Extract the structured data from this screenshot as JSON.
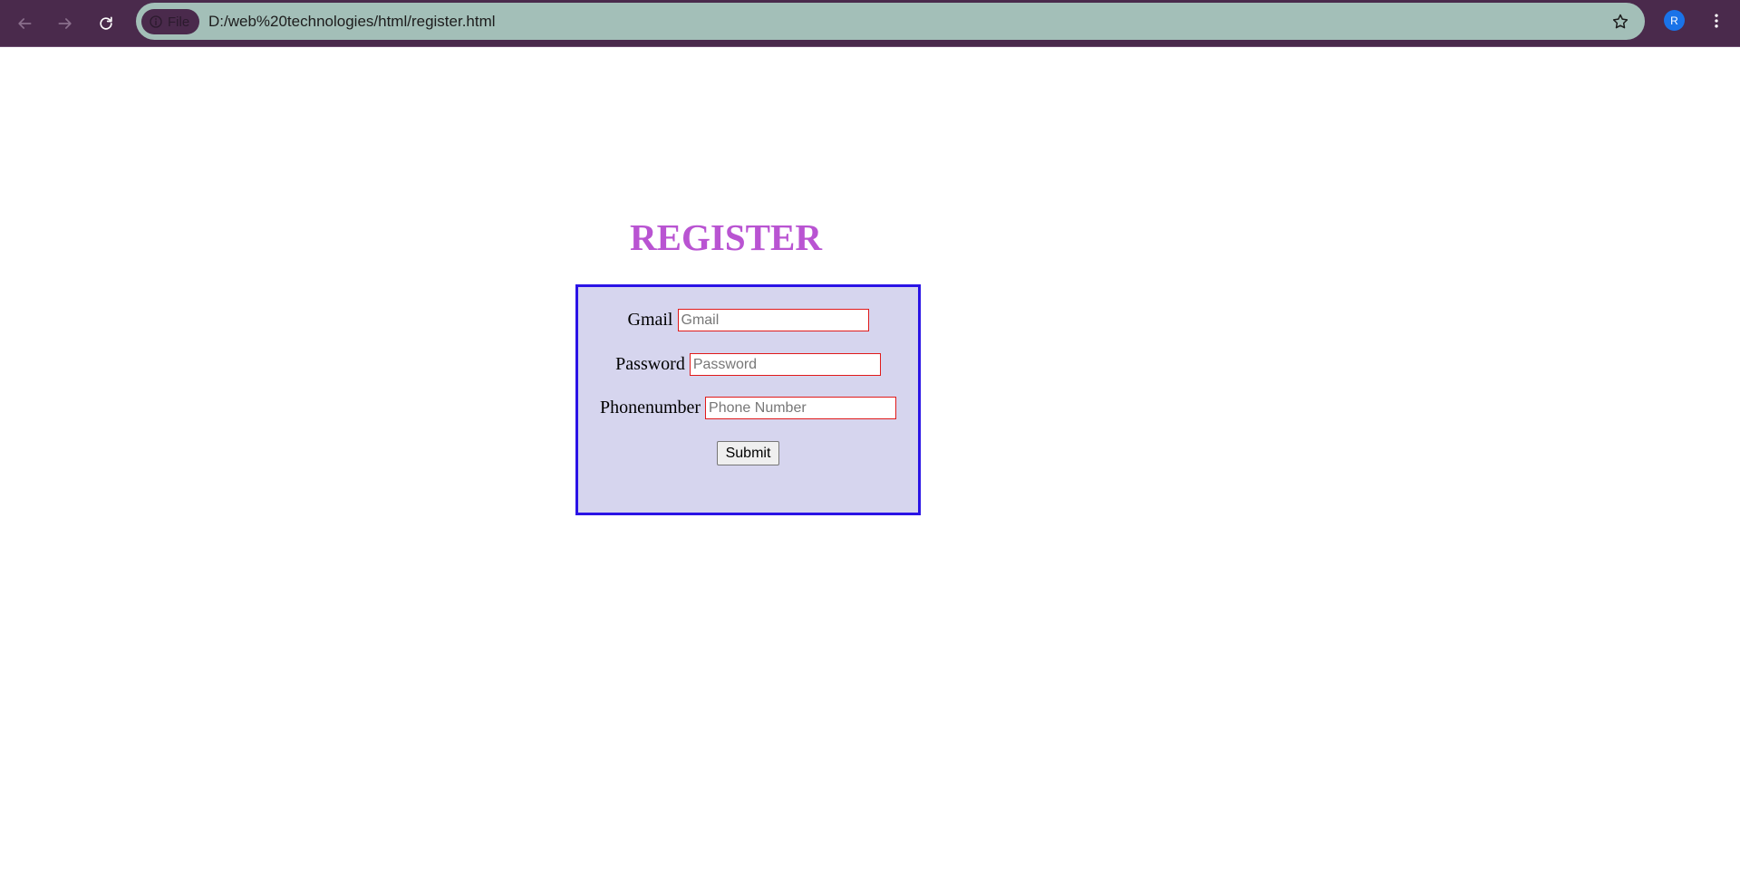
{
  "browser": {
    "chip_label": "File",
    "url": "D:/web%20technologies/html/register.html",
    "avatar_letter": "R",
    "colors": {
      "toolbar": "#4a2a4c",
      "omnibox": "#a3bfb8",
      "avatar": "#1a73e8"
    }
  },
  "page": {
    "title": "REGISTER",
    "form": {
      "gmail_label": "Gmail",
      "gmail_placeholder": "Gmail",
      "password_label": "Password",
      "password_placeholder": "Password",
      "phone_label": "Phonenumber",
      "phone_placeholder": "Phone Number",
      "submit_label": "Submit"
    },
    "colors": {
      "title": "#b954d2",
      "box_background": "#d6d5ee",
      "box_border": "#2a13e6",
      "input_border": "#e01a1a"
    }
  }
}
